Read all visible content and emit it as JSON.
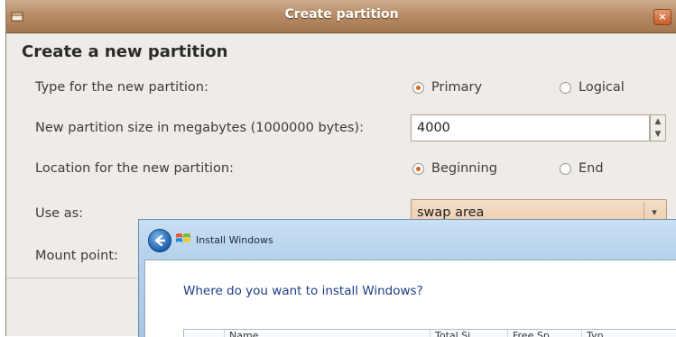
{
  "ubuntu_dialog": {
    "title": "Create partition",
    "close": "×",
    "heading": "Create a new partition",
    "type_label": "Type for the new partition:",
    "type_options": {
      "primary": "Primary",
      "logical": "Logical",
      "selected": "Primary"
    },
    "size_label": "New partition size in megabytes (1000000 bytes):",
    "size_value": "4000",
    "location_label": "Location for the new partition:",
    "location_options": {
      "beginning": "Beginning",
      "end": "End",
      "selected": "Beginning"
    },
    "use_as_label": "Use as:",
    "use_as_value": "swap area",
    "mount_point_label": "Mount point:"
  },
  "windows_installer": {
    "title": "Install Windows",
    "question": "Where do you want to install Windows?",
    "columns": [
      "",
      "Name",
      "Total Si",
      "Free Sp",
      "Typ"
    ]
  },
  "colors": {
    "ubuntu_titlebar": "#b78c66",
    "ubuntu_accent": "#d4681f",
    "windows_link": "#1e3d8a"
  }
}
